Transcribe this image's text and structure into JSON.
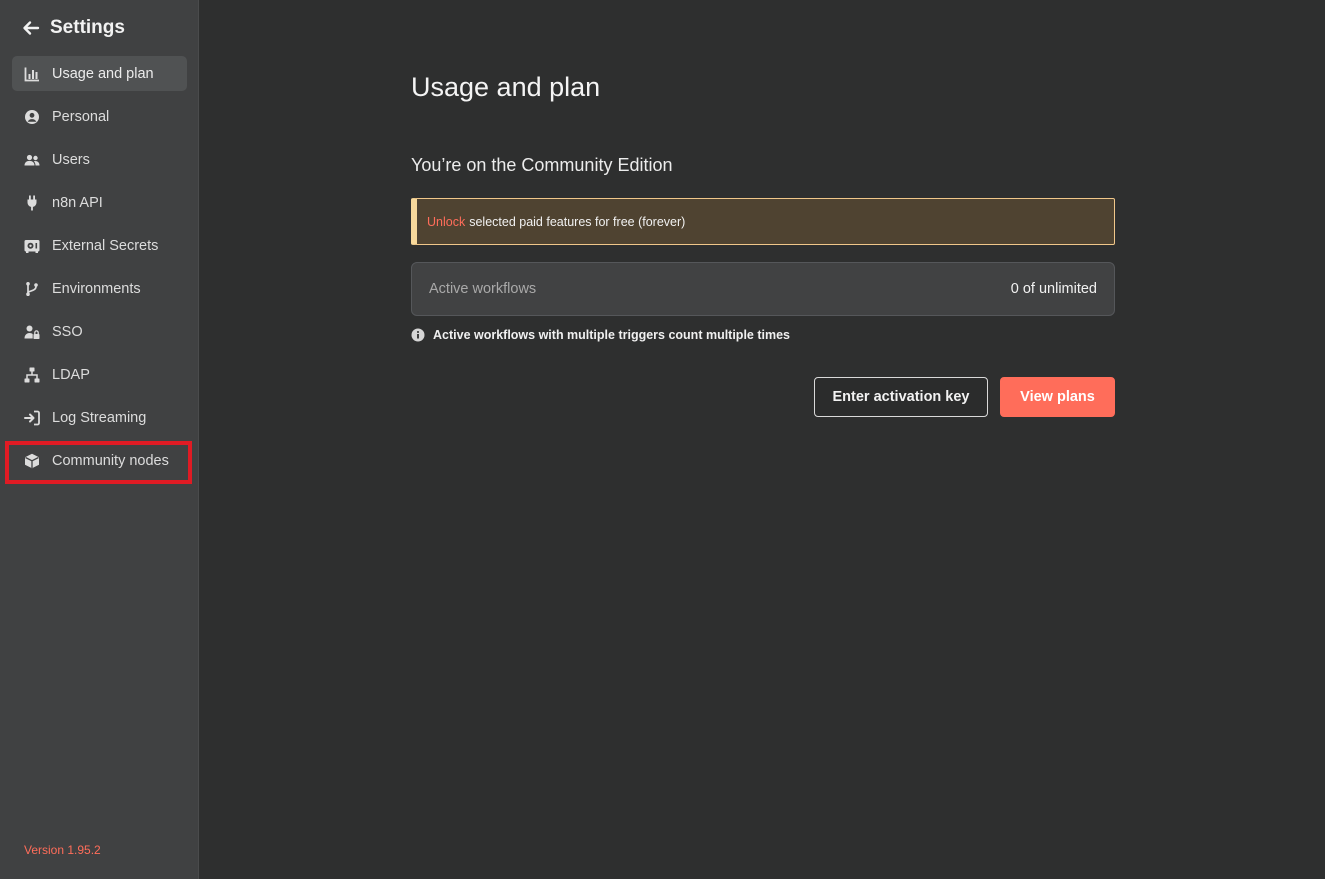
{
  "sidebar": {
    "title": "Settings",
    "items": [
      {
        "label": "Usage and plan",
        "icon": "chart-bar-icon",
        "active": true
      },
      {
        "label": "Personal",
        "icon": "user-circle-icon"
      },
      {
        "label": "Users",
        "icon": "users-icon"
      },
      {
        "label": "n8n API",
        "icon": "plug-icon"
      },
      {
        "label": "External Secrets",
        "icon": "vault-icon"
      },
      {
        "label": "Environments",
        "icon": "code-branch-icon"
      },
      {
        "label": "SSO",
        "icon": "user-lock-icon"
      },
      {
        "label": "LDAP",
        "icon": "network-wired-icon"
      },
      {
        "label": "Log Streaming",
        "icon": "sign-in-icon"
      },
      {
        "label": "Community nodes",
        "icon": "cube-icon"
      }
    ],
    "version": "Version 1.95.2"
  },
  "main": {
    "title": "Usage and plan",
    "subtitle": "You’re on the Community Edition",
    "callout": {
      "link": "Unlock",
      "text": "selected paid features for free (forever)"
    },
    "usage": {
      "label": "Active workflows",
      "value": "0 of unlimited"
    },
    "note": "Active workflows with multiple triggers count multiple times",
    "buttons": {
      "activation": "Enter activation key",
      "plans": "View plans"
    }
  },
  "colors": {
    "accent": "#ff6d5a",
    "highlight": "#e01b24",
    "warning_border": "#f8d99b"
  }
}
